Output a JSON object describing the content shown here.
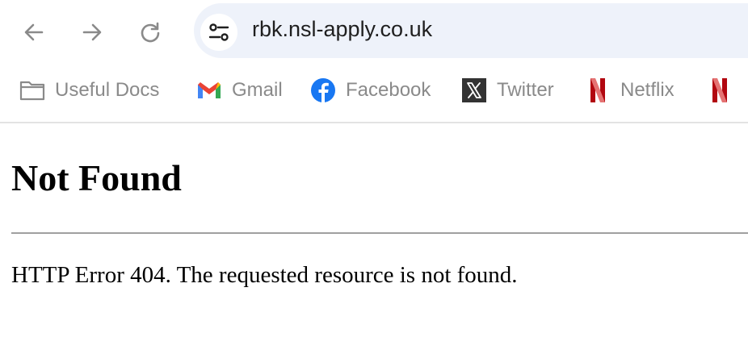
{
  "toolbar": {
    "back_icon": "arrow-left-icon",
    "forward_icon": "arrow-right-icon",
    "reload_icon": "reload-icon",
    "site_info_icon": "tune-icon"
  },
  "address_bar": {
    "url": "rbk.nsl-apply.co.uk"
  },
  "bookmarks": [
    {
      "label": "Useful Docs",
      "icon": "folder-icon"
    },
    {
      "label": "Gmail",
      "icon": "gmail-icon"
    },
    {
      "label": "Facebook",
      "icon": "facebook-icon"
    },
    {
      "label": "Twitter",
      "icon": "x-icon"
    },
    {
      "label": "Netflix",
      "icon": "netflix-icon"
    },
    {
      "label": "",
      "icon": "netflix-icon"
    }
  ],
  "page": {
    "heading": "Not Found",
    "message": "HTTP Error 404. The requested resource is not found."
  },
  "colors": {
    "omnibox_bg": "#eef2fa",
    "bookmark_text": "#8a8a8a",
    "facebook_blue": "#1877f2",
    "netflix_red": "#e50914"
  }
}
